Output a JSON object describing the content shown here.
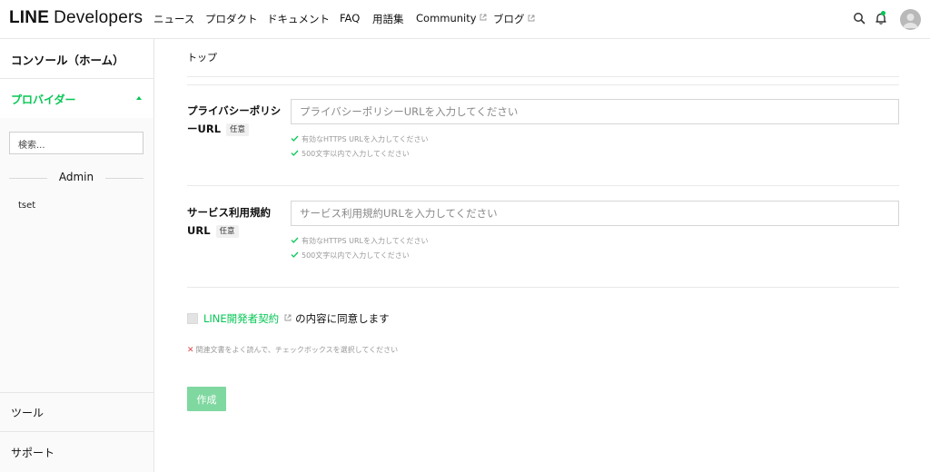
{
  "header": {
    "logo_bold": "LINE",
    "logo_rest": "Developers",
    "nav": [
      "ニュース",
      "プロダクト",
      "ドキュメント",
      "FAQ",
      "用語集",
      "Community",
      "ブログ"
    ]
  },
  "sidebar": {
    "home": "コンソール（ホーム）",
    "provider": "プロバイダー",
    "search_placeholder": "検索...",
    "group_label": "Admin",
    "providers": [
      "tset"
    ],
    "tools": "ツール",
    "support": "サポート"
  },
  "main": {
    "breadcrumb": "トップ",
    "privacy": {
      "label_line1": "プライバシーポリシ",
      "label_line2": "ーURL",
      "badge": "任意",
      "placeholder": "プライバシーポリシーURLを入力してください",
      "hint1": "有効なHTTPS URLを入力してください",
      "hint2": "500文字以内で入力してください"
    },
    "terms": {
      "label_line1": "サービス利用規約",
      "label_line2": "URL",
      "badge": "任意",
      "placeholder": "サービス利用規約URLを入力してください",
      "hint1": "有効なHTTPS URLを入力してください",
      "hint2": "500文字以内で入力してください"
    },
    "agreement_link": "LINE開発者契約",
    "agreement_rest": "の内容に同意します",
    "error": "関連文書をよく読んで、チェックボックスを選択してください",
    "create_button": "作成"
  },
  "colors": {
    "brand_green": "#06c755",
    "button_disabled": "#7fd8a0",
    "error_red": "#e0464e"
  },
  "icons": {
    "search": "search-icon",
    "bell": "bell-icon",
    "external": "external-link-icon",
    "check": "check-icon",
    "error": "x-icon"
  }
}
